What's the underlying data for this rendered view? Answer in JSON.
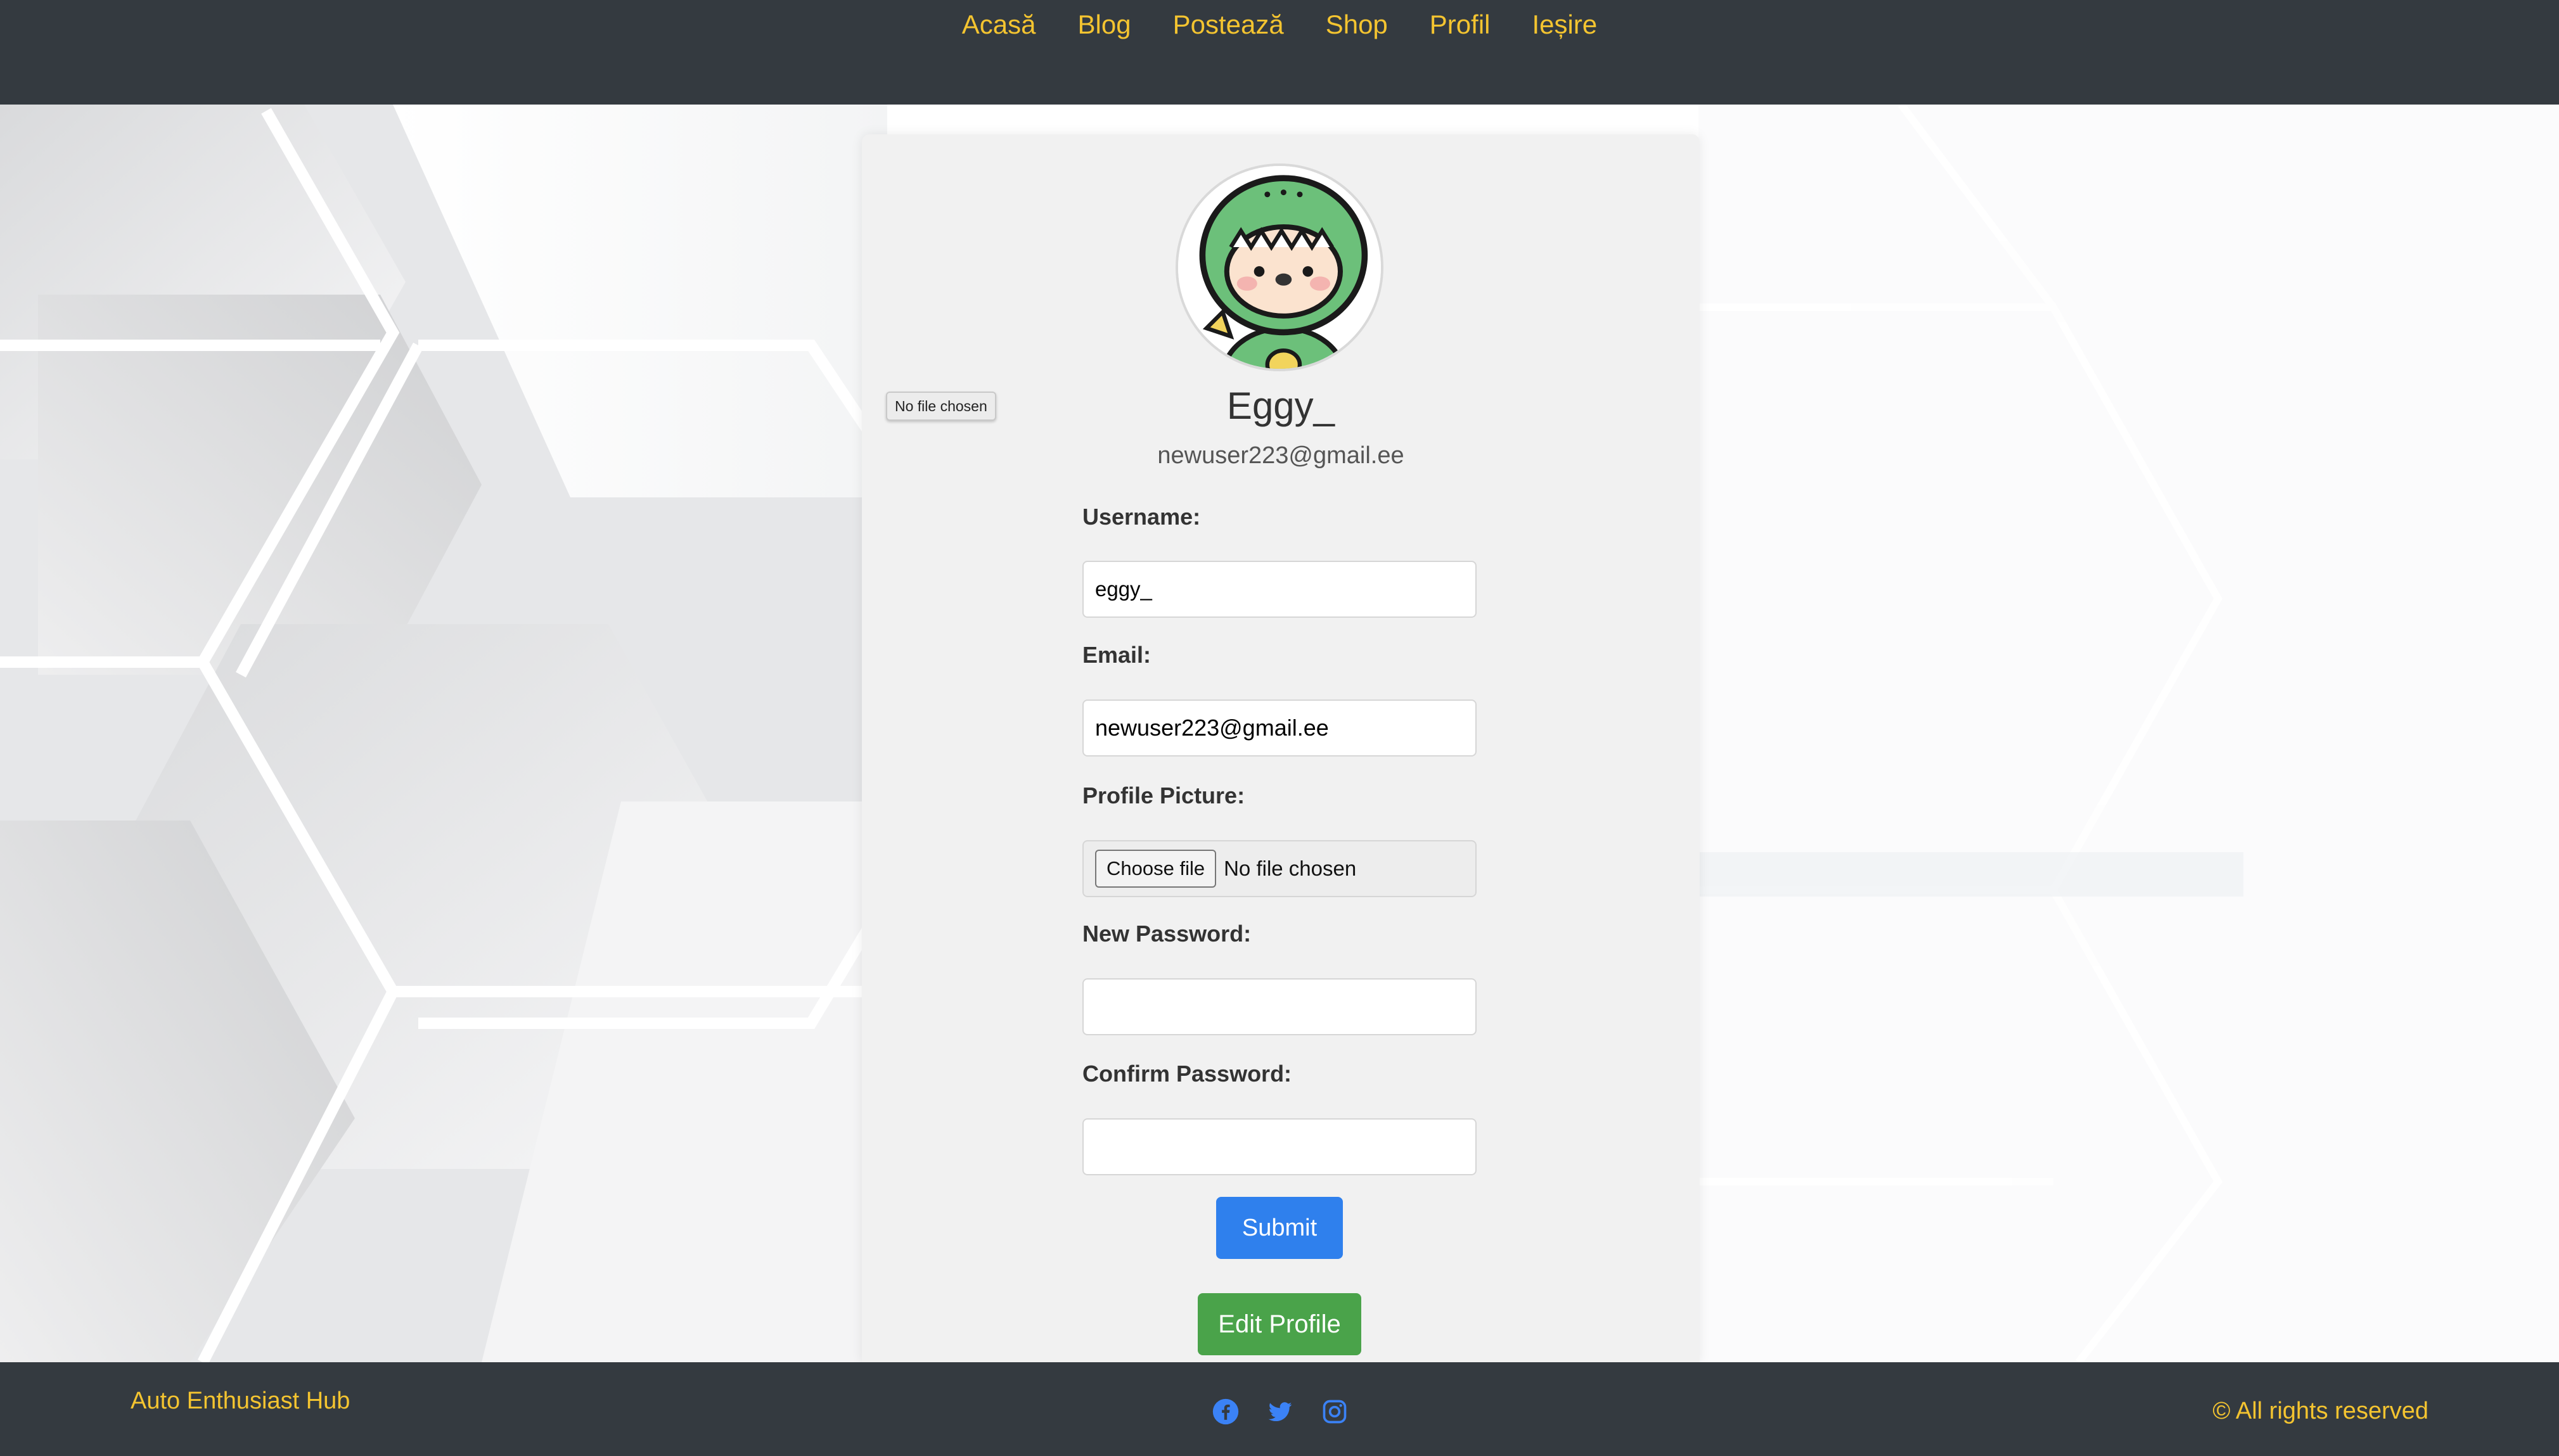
{
  "nav": {
    "items": [
      "Acasă",
      "Blog",
      "Postează",
      "Shop",
      "Profil",
      "Ieșire"
    ]
  },
  "profile": {
    "display_name": "Eggy_",
    "display_email": "newuser223@gmail.ee",
    "avatar_icon": "dinosaur-costume-avatar",
    "hidden_file_text": "No file chosen"
  },
  "form": {
    "username_label": "Username:",
    "username_value": "eggy_",
    "email_label": "Email:",
    "email_value": "newuser223@gmail.ee",
    "picture_label": "Profile Picture:",
    "choose_file_label": "Choose file",
    "no_file_text": "No file chosen",
    "new_password_label": "New Password:",
    "new_password_value": "",
    "confirm_password_label": "Confirm Password:",
    "confirm_password_value": "",
    "submit_label": "Submit",
    "edit_profile_label": "Edit Profile"
  },
  "footer": {
    "brand": "Auto Enthusiast Hub",
    "rights": "© All rights reserved",
    "social_icons": [
      "facebook-icon",
      "twitter-icon",
      "instagram-icon"
    ]
  },
  "colors": {
    "nav_bg": "#343a40",
    "accent_yellow": "#f4c430",
    "submit_blue": "#2f80ed",
    "edit_green": "#4aa34a",
    "social_blue": "#3b82f6"
  }
}
